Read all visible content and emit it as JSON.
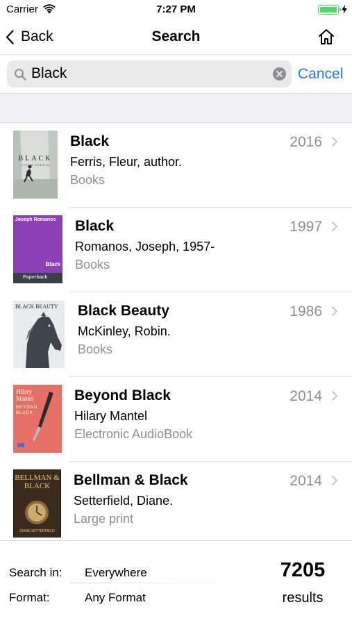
{
  "status_bar": {
    "carrier": "Carrier",
    "time": "7:27 PM",
    "battery_level": 1.0
  },
  "nav": {
    "back_label": "Back",
    "title": "Search",
    "home_icon": "home-icon"
  },
  "search": {
    "query": "Black",
    "cancel_label": "Cancel"
  },
  "results": [
    {
      "title": "Black",
      "author": "Ferris, Fleur, author.",
      "format": "Books",
      "year": "2016",
      "cover": {
        "main_text": "BLACK",
        "sub_text": "FLEUR FERRIS",
        "bg": "#d7dcd6"
      }
    },
    {
      "title": "Black",
      "author": "Romanos, Joseph, 1957-",
      "format": "Books",
      "year": "1997",
      "cover": {
        "top_text": "Joseph Romanos",
        "main_text": "Black",
        "band_text": "Paperback",
        "bg": "#8c3fb4"
      }
    },
    {
      "title": "Black Beauty",
      "author": "McKinley, Robin.",
      "format": "Books",
      "year": "1986",
      "cover": {
        "main_text": "BLACK BEAUTY",
        "bg": "#e6e8ea"
      }
    },
    {
      "title": "Beyond Black",
      "author": "Hilary Mantel",
      "format": "Electronic AudioBook",
      "year": "2014",
      "cover": {
        "top_text": "Hilary Mantel",
        "main_text": "BEYOND BLACK",
        "bg": "#e46d62"
      }
    },
    {
      "title": "Bellman & Black",
      "author": "Setterfield, Diane.",
      "format": "Large print",
      "year": "2014",
      "cover": {
        "main_text": "BELLMAN & BLACK",
        "sub_text": "DIANE SETTERFIELD",
        "bg": "#3a2a1c"
      }
    }
  ],
  "footer": {
    "search_in_label": "Search in:",
    "search_in_value": "Everywhere",
    "format_label": "Format:",
    "format_value": "Any Format",
    "count": "7205",
    "count_label": "results"
  },
  "colors": {
    "accent": "#1a7ee6",
    "secondary_text": "#8e8e93",
    "battery": "#4cd964"
  }
}
